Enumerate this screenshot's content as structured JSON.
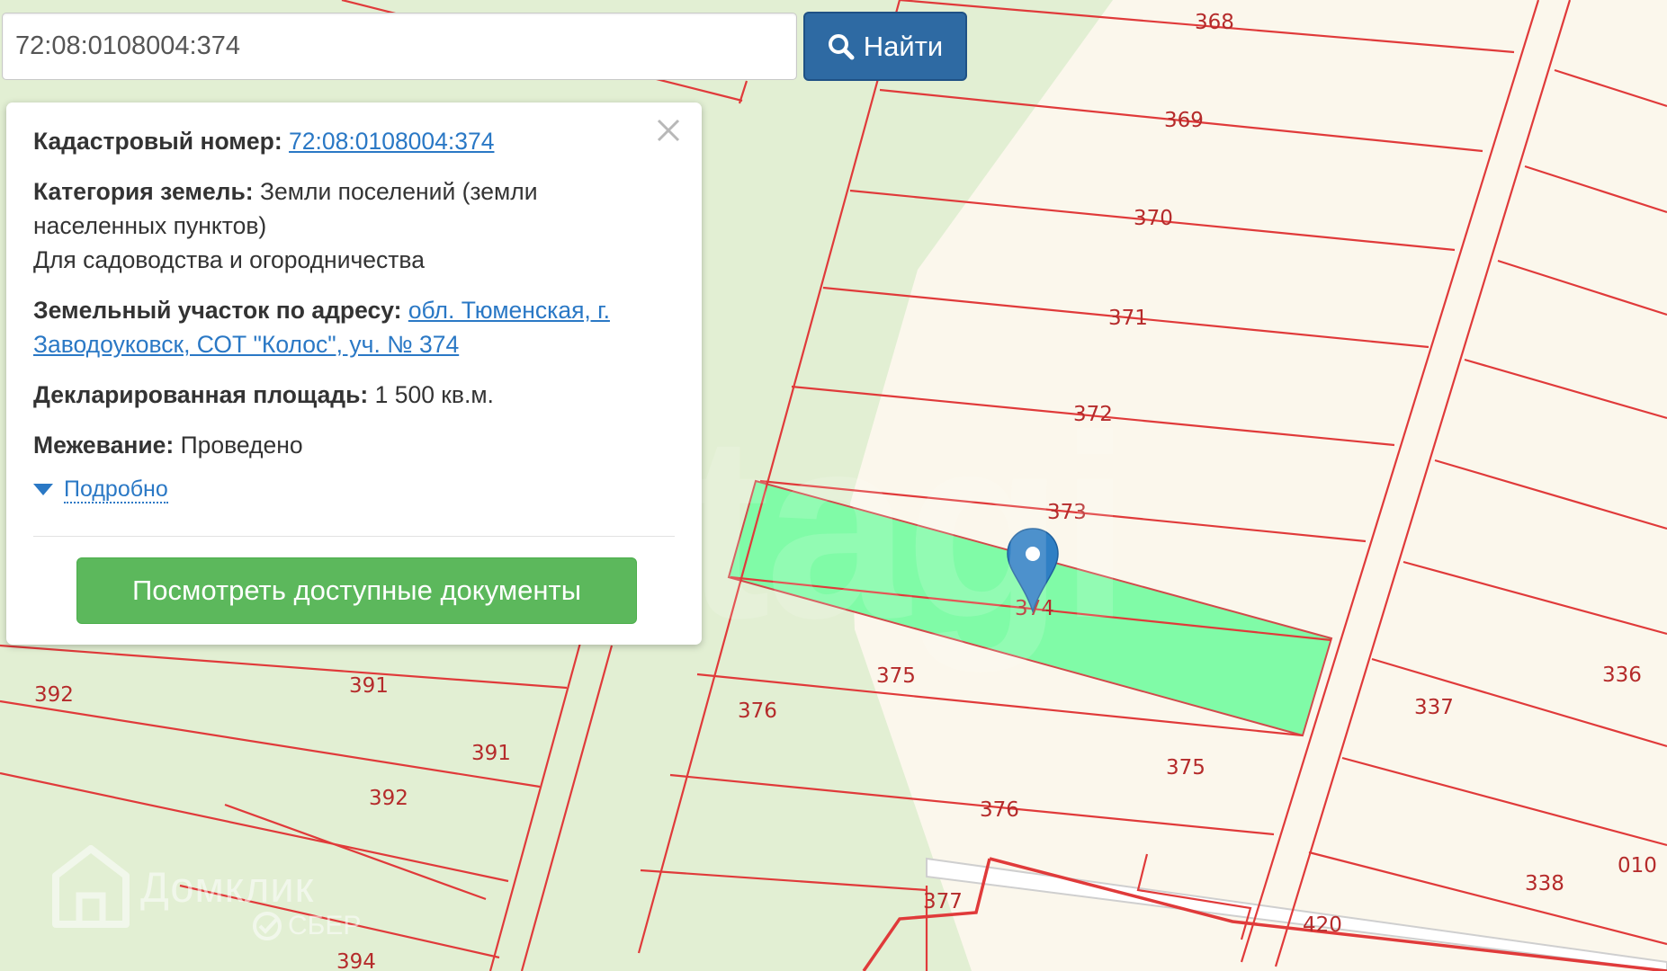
{
  "search": {
    "value": "72:08:0108004:374",
    "button_label": "Найти"
  },
  "info_panel": {
    "cadastral_label": "Кадастровый номер:",
    "cadastral_value": "72:08:0108004:374",
    "category_label": "Категория земель:",
    "category_value_line1": "Земли поселений (земли",
    "category_value_line2": "населенных пунктов)",
    "category_use": "Для садоводства и огородничества",
    "address_label": "Земельный участок по адресу:",
    "address_line1": "обл. Тюменская, г.",
    "address_line2": "Заводоуковск, СОТ \"Колос\", уч. № 374",
    "area_label": "Декларированная площадь:",
    "area_value": "1 500 кв.м.",
    "survey_label": "Межевание:",
    "survey_value": "Проведено",
    "more_link": "Подробно",
    "docs_button": "Посмотреть доступные документы"
  },
  "map": {
    "parcel_labels": [
      "368",
      "369",
      "370",
      "371",
      "372",
      "373",
      "374",
      "375",
      "376",
      "375",
      "376",
      "377",
      "420",
      "336",
      "337",
      "338",
      "391",
      "391",
      "392",
      "392",
      "394",
      "010"
    ],
    "selected_parcel": "374",
    "colors": {
      "background_green": "#e2efd3",
      "cream": "#fbf7ec",
      "boundary": "#e03a3a",
      "selected_fill": "#80fba7",
      "marker": "#2f7fc4"
    }
  },
  "watermark": {
    "brand": "Домклик",
    "sub": "СБЕР",
    "faint": "tagi"
  }
}
